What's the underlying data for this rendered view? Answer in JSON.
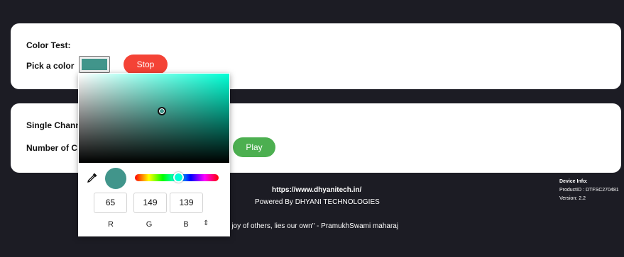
{
  "card1": {
    "title": "Color Test:",
    "pick_label": "Pick a color",
    "stop_label": "Stop",
    "color": "#41958b"
  },
  "card2": {
    "single_label": "Single Chann",
    "number_label": "Number of C",
    "play_label": "Play"
  },
  "picker": {
    "r": "65",
    "g": "149",
    "b": "139",
    "r_label": "R",
    "g_label": "G",
    "b_label": "B",
    "toggle_icon": "up-down-arrows-icon",
    "hue_color": "#00ffd5"
  },
  "footer": {
    "url": "https://www.dhyanitech.in/",
    "powered": "Powered By DHYANI TECHNOLOGIES",
    "quote": "e joy of others, lies our own\" - PramukhSwami maharaj"
  },
  "device": {
    "title": "Device Info:",
    "product": "ProductID : DTFSC270481",
    "version": "Version: 2.2"
  },
  "colors": {
    "stop": "#f44336",
    "play": "#4caf50",
    "background": "#1c1c24"
  }
}
